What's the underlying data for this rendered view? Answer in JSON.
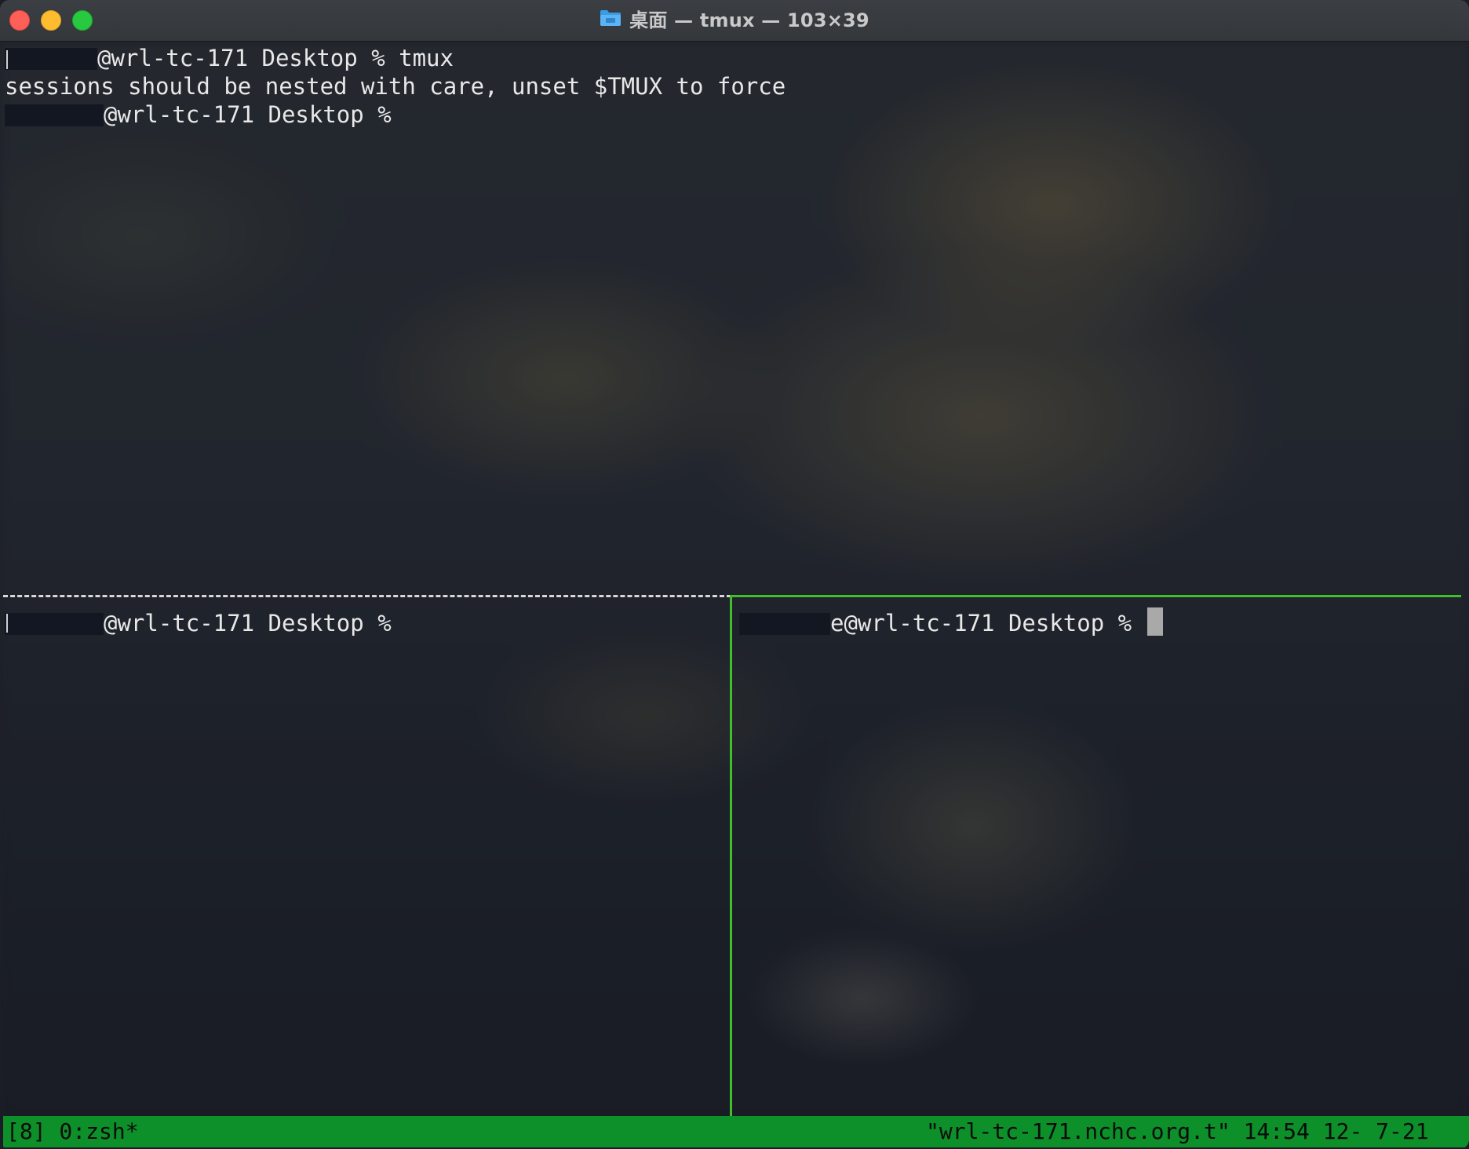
{
  "window": {
    "title": "桌面 — tmux — 103×39",
    "folder_icon": "folder-icon",
    "controls": [
      "close",
      "minimize",
      "zoom"
    ]
  },
  "top_pane": {
    "lines": [
      {
        "user_redacted": true,
        "text": "@wrl-tc-171 Desktop % tmux"
      },
      {
        "user_redacted": false,
        "text": "sessions should be nested with care, unset $TMUX to force"
      },
      {
        "user_redacted": true,
        "text": "@wrl-tc-171 Desktop %"
      }
    ]
  },
  "bottom_left_pane": {
    "prompt": "@wrl-tc-171 Desktop %"
  },
  "bottom_right_pane": {
    "prompt": "e@wrl-tc-171 Desktop %"
  },
  "status_bar": {
    "left": "[8] 0:zsh*",
    "right": "\"wrl-tc-171.nchc.org.t\" 14:54 12- 7-21",
    "colors": {
      "background": "#0d8f2a",
      "text": "#0b0b0b"
    }
  },
  "colors": {
    "active_pane_border": "#3fbf2b",
    "inactive_pane_border": "#d8d8d8",
    "terminal_text": "#e8e8e8"
  }
}
